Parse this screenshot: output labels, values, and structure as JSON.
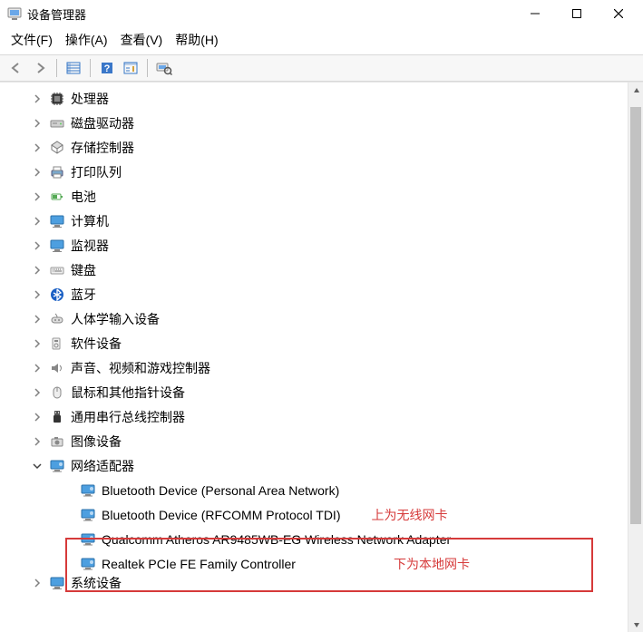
{
  "window": {
    "title": "设备管理器"
  },
  "menu": {
    "file": "文件(F)",
    "action": "操作(A)",
    "view": "查看(V)",
    "help": "帮助(H)"
  },
  "tree": {
    "nodes": [
      {
        "label": "处理器",
        "icon": "cpu"
      },
      {
        "label": "磁盘驱动器",
        "icon": "disk"
      },
      {
        "label": "存储控制器",
        "icon": "storage"
      },
      {
        "label": "打印队列",
        "icon": "printer"
      },
      {
        "label": "电池",
        "icon": "battery"
      },
      {
        "label": "计算机",
        "icon": "monitor"
      },
      {
        "label": "监视器",
        "icon": "monitor"
      },
      {
        "label": "键盘",
        "icon": "keyboard"
      },
      {
        "label": "蓝牙",
        "icon": "bluetooth"
      },
      {
        "label": "人体学输入设备",
        "icon": "hid"
      },
      {
        "label": "软件设备",
        "icon": "software"
      },
      {
        "label": "声音、视频和游戏控制器",
        "icon": "sound"
      },
      {
        "label": "鼠标和其他指针设备",
        "icon": "mouse"
      },
      {
        "label": "通用串行总线控制器",
        "icon": "usb"
      },
      {
        "label": "图像设备",
        "icon": "camera"
      },
      {
        "label": "网络适配器",
        "icon": "network",
        "expanded": true
      }
    ],
    "network_children": [
      "Bluetooth Device (Personal Area Network)",
      "Bluetooth Device (RFCOMM Protocol TDI)",
      "Qualcomm Atheros AR9485WB-EG Wireless Network Adapter",
      "Realtek PCIe FE Family Controller"
    ],
    "partial_bottom": "系统设备"
  },
  "annotations": {
    "top": "上为无线网卡",
    "bottom": "下为本地网卡"
  }
}
